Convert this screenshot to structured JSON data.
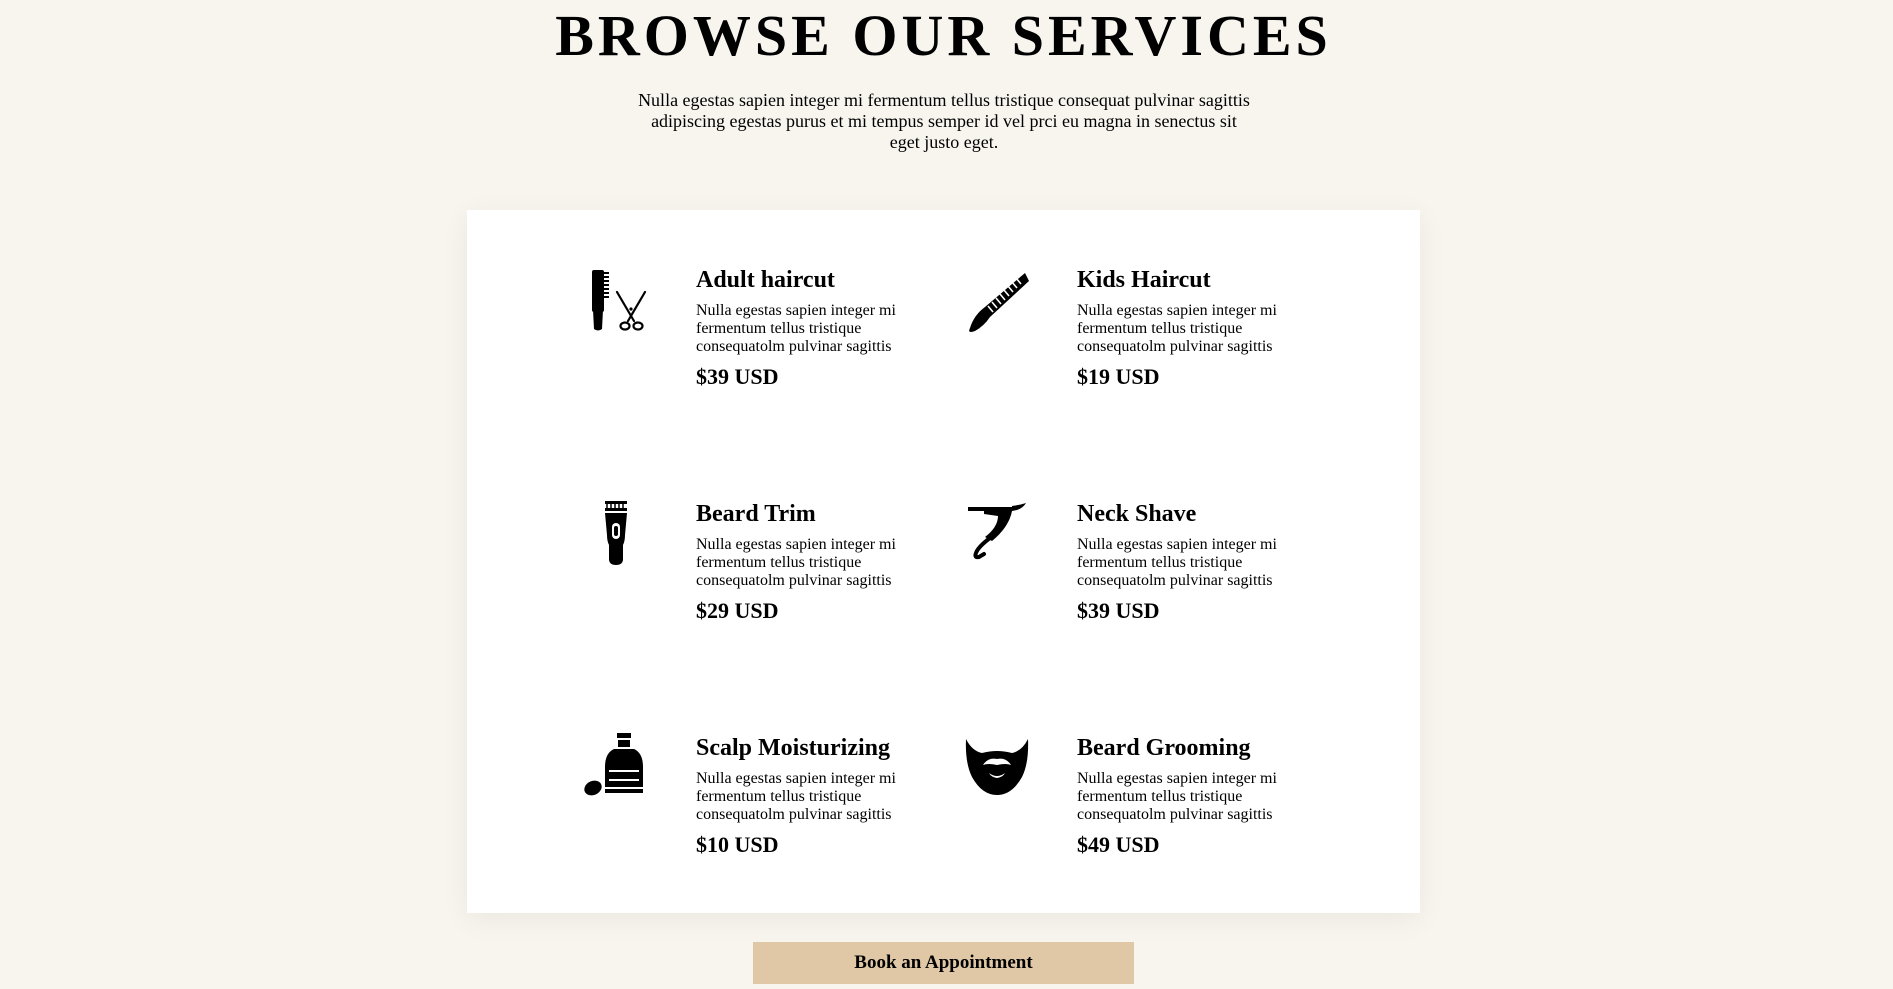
{
  "header": {
    "title": "BROWSE OUR SERVICES",
    "intro": "Nulla egestas sapien integer mi fermentum tellus tristique consequat pulvinar sagittis adipiscing egestas purus et mi tempus semper id vel prci eu magna in senectus sit eget justo eget."
  },
  "services": [
    {
      "name": "Adult haircut",
      "description": "Nulla egestas sapien integer mi fermentum tellus tristique consequatolm pulvinar sagittis",
      "price": "$39 USD",
      "icon": "comb-scissors-icon"
    },
    {
      "name": "Kids Haircut",
      "description": "Nulla egestas sapien integer mi fermentum tellus tristique consequatolm pulvinar sagittis",
      "price": "$19 USD",
      "icon": "comb-icon"
    },
    {
      "name": "Beard Trim",
      "description": "Nulla egestas sapien integer mi fermentum tellus tristique consequatolm pulvinar sagittis",
      "price": "$29 USD",
      "icon": "trimmer-icon"
    },
    {
      "name": "Neck Shave",
      "description": "Nulla egestas sapien integer mi fermentum tellus tristique consequatolm pulvinar sagittis",
      "price": "$39 USD",
      "icon": "razor-icon"
    },
    {
      "name": "Scalp Moisturizing",
      "description": "Nulla egestas sapien integer mi fermentum tellus tristique consequatolm pulvinar sagittis",
      "price": "$10 USD",
      "icon": "bottle-icon"
    },
    {
      "name": "Beard Grooming",
      "description": "Nulla egestas sapien integer mi fermentum tellus tristique consequatolm pulvinar sagittis",
      "price": "$49 USD",
      "icon": "beard-icon"
    }
  ],
  "cta": {
    "label": "Book an Appointment"
  },
  "colors": {
    "background": "#f8f5ef",
    "card": "#ffffff",
    "button": "#e0c7a6",
    "text": "#000000"
  }
}
